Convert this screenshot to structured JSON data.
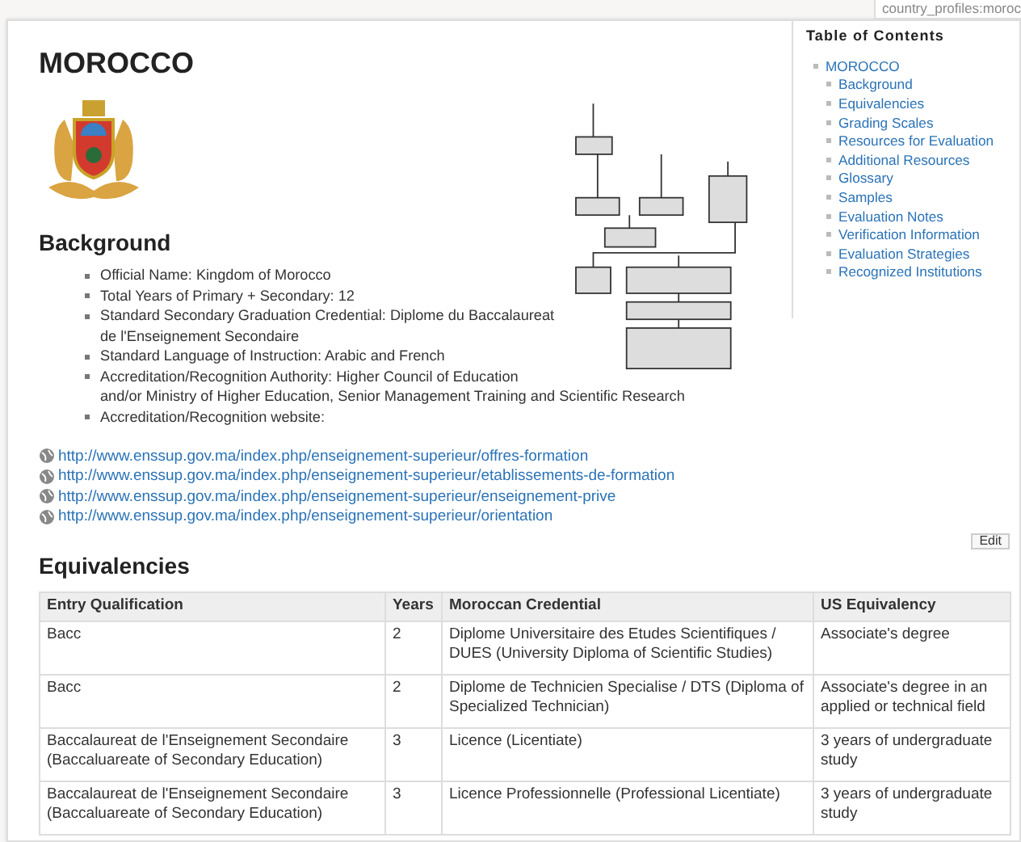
{
  "breadcrumb": "country_profiles:moroc",
  "title": "MOROCCO",
  "toc": {
    "title": "Table of Contents",
    "items": [
      {
        "label": "MOROCCO",
        "children": [
          {
            "label": "Background"
          },
          {
            "label": "Equivalencies"
          },
          {
            "label": "Grading Scales"
          },
          {
            "label": "Resources for Evaluation"
          },
          {
            "label": "Additional Resources"
          },
          {
            "label": "Glossary"
          },
          {
            "label": "Samples"
          },
          {
            "label": "Evaluation Notes"
          },
          {
            "label": "Verification Information"
          },
          {
            "label": "Evaluation Strategies"
          },
          {
            "label": "Recognized Institutions"
          }
        ]
      }
    ]
  },
  "background": {
    "heading": "Background",
    "facts": [
      {
        "lines": [
          "Official Name: Kingdom of Morocco"
        ]
      },
      {
        "lines": [
          "Total Years of Primary + Secondary: 12"
        ]
      },
      {
        "lines": [
          "Standard Secondary Graduation Credential: Diplome du Baccalaureat",
          "de l'Enseignement Secondaire"
        ]
      },
      {
        "lines": [
          "Standard Language of Instruction: Arabic and French"
        ]
      },
      {
        "lines": [
          "Accreditation/Recognition Authority: Higher Council of Education",
          "and/or Ministry of Higher Education, Senior Management Training and Scientific Research"
        ]
      },
      {
        "lines": [
          "Accreditation/Recognition website:"
        ]
      }
    ],
    "links": [
      "http://www.enssup.gov.ma/index.php/enseignement-superieur/offres-formation",
      "http://www.enssup.gov.ma/index.php/enseignement-superieur/etablissements-de-formation",
      "http://www.enssup.gov.ma/index.php/enseignement-superieur/enseignement-prive",
      "http://www.enssup.gov.ma/index.php/enseignement-superieur/orientation"
    ]
  },
  "edit_button": "Edit",
  "equivalencies": {
    "heading": "Equivalencies",
    "columns": [
      "Entry Qualification",
      "Years",
      "Moroccan Credential",
      "US Equivalency"
    ],
    "rows": [
      [
        "Bacc",
        "2",
        "Diplome Universitaire des Etudes Scientifiques / DUES (University Diploma of Scientific Studies)",
        "Associate's degree"
      ],
      [
        "Bacc",
        "2",
        "Diplome de Technicien Specialise / DTS (Diploma of Specialized Technician)",
        "Associate's degree in an applied or technical field"
      ],
      [
        "Baccalaureat de l'Enseignement Secondaire (Baccaluareate of Secondary Education)",
        "3",
        "Licence (Licentiate)",
        "3 years of undergraduate study"
      ],
      [
        "Baccalaureat de l'Enseignement Secondaire (Baccaluareate of Secondary Education)",
        "3",
        "Licence Professionnelle (Professional Licentiate)",
        "3 years of undergraduate study"
      ]
    ]
  }
}
